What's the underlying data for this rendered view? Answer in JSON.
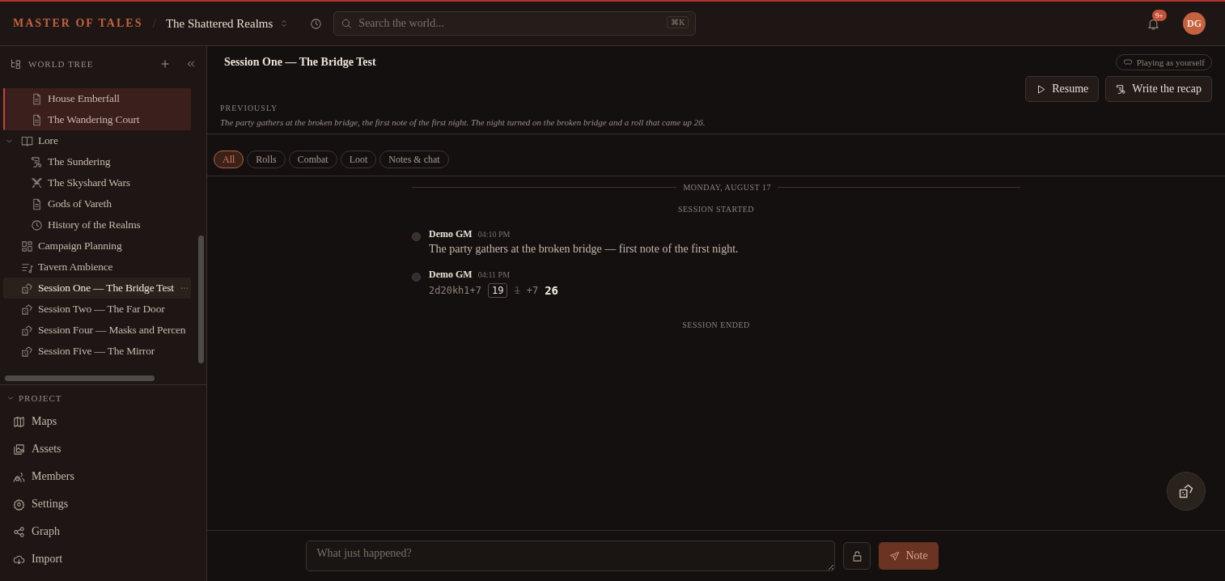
{
  "header": {
    "brand": "MASTER OF TALES",
    "separator": "/",
    "world": "The Shattered Realms",
    "search": {
      "placeholder": "Search the world...",
      "shortcut": "⌘K"
    },
    "notifications": "9+",
    "avatar": "DG"
  },
  "sidebar": {
    "tree_title": "WORLD TREE",
    "tree": [
      {
        "highlighted": true,
        "children": [
          {
            "label": "House Emberfall",
            "kind": "page",
            "selected": false
          },
          {
            "label": "The Wandering Court",
            "kind": "page",
            "selected": false
          }
        ]
      },
      {
        "label": "Lore",
        "kind": "book",
        "expanded": true,
        "selected": false,
        "children": [
          {
            "label": "The Sundering",
            "kind": "scroll",
            "selected": false
          },
          {
            "label": "The Skyshard Wars",
            "kind": "swords",
            "selected": false
          },
          {
            "label": "Gods of Vareth",
            "kind": "page",
            "selected": false
          },
          {
            "label": "History of the Realms",
            "kind": "clock",
            "selected": false
          }
        ]
      },
      {
        "label": "Campaign Planning",
        "kind": "board",
        "selected": false
      },
      {
        "label": "Tavern Ambience",
        "kind": "playlist",
        "selected": false
      },
      {
        "label": "Session One — The Bridge Test",
        "kind": "dice",
        "selected": true
      },
      {
        "label": "Session Two — The Far Door",
        "kind": "dice",
        "selected": false
      },
      {
        "label": "Session Four — Masks and Percen",
        "kind": "dice",
        "selected": false
      },
      {
        "label": "Session Five — The Mirror",
        "kind": "dice",
        "selected": false
      }
    ],
    "project_title": "PROJECT",
    "project_expanded": true,
    "project": [
      {
        "label": "Maps",
        "kind": "map"
      },
      {
        "label": "Assets",
        "kind": "image"
      },
      {
        "label": "Members",
        "kind": "users"
      },
      {
        "label": "Settings",
        "kind": "gear"
      },
      {
        "label": "Graph",
        "kind": "graph"
      },
      {
        "label": "Import",
        "kind": "cloud"
      }
    ]
  },
  "session": {
    "title": "Session One — The Bridge Test",
    "persona": "Playing as yourself",
    "buttons": [
      {
        "label": "Resume",
        "kind": "play"
      },
      {
        "label": "Write the recap",
        "kind": "scroll"
      }
    ],
    "previously_label": "PREVIOUSLY",
    "previously": "The party gathers at the broken bridge, the first note of the first night. The night turned on the broken bridge and a roll that came up 26."
  },
  "filters": [
    {
      "label": "All",
      "selected": true
    },
    {
      "label": "Rolls",
      "selected": false
    },
    {
      "label": "Combat",
      "selected": false
    },
    {
      "label": "Loot",
      "selected": false
    },
    {
      "label": "Notes & chat",
      "selected": false
    }
  ],
  "timeline": [
    {
      "kind": "date",
      "text": "MONDAY, AUGUST 17"
    },
    {
      "kind": "system",
      "text": "SESSION STARTED"
    },
    {
      "kind": "note",
      "author": "Demo GM",
      "time": "04:10 PM",
      "color": "#3a2f29",
      "text": "The party gathers at the broken bridge — first note of the first night."
    },
    {
      "kind": "roll",
      "author": "Demo GM",
      "time": "04:11 PM",
      "color": "#2b2f33",
      "formula": "2d20kh1+7",
      "dice": [
        {
          "value": "19",
          "kept": true
        },
        {
          "value": "1",
          "kept": false
        }
      ],
      "modifier": "+7",
      "total": "26"
    },
    {
      "kind": "system",
      "text": "SESSION ENDED"
    }
  ],
  "composer": {
    "placeholder": "What just happened?",
    "send": "Note"
  }
}
